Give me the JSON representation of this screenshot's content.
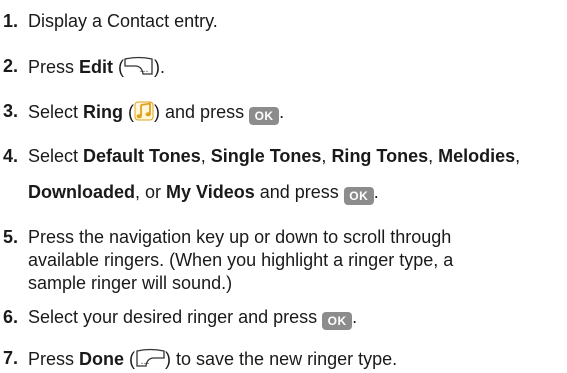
{
  "steps": [
    {
      "num": "1.",
      "parts": {
        "t1": "Display a Contact entry."
      }
    },
    {
      "num": "2.",
      "parts": {
        "t1": "Press ",
        "b1": "Edit",
        "t2": " (",
        "t3": ")."
      }
    },
    {
      "num": "3.",
      "parts": {
        "t1": "Select ",
        "b1": "Ring",
        "t2": " (",
        "t3": ") and press ",
        "t4": "."
      }
    },
    {
      "num": "4.",
      "parts": {
        "t1": "Select ",
        "b1": "Default Tones",
        "t2": ", ",
        "b2": "Single Tones",
        "t3": ", ",
        "b3": "Ring Tones",
        "t4": ", ",
        "b4": "Melodies",
        "t5": ",",
        "b5": "Downloaded",
        "t6": ", or ",
        "b6": "My Videos",
        "t7": " and press ",
        "t8": "."
      }
    },
    {
      "num": "5.",
      "lines": [
        "Press the navigation key up or down to scroll through",
        "available ringers. (When you highlight a ringer type, a",
        "sample ringer will sound.)"
      ]
    },
    {
      "num": "6.",
      "parts": {
        "t1": "Select your desired ringer and press ",
        "t2": "."
      }
    },
    {
      "num": "7.",
      "parts": {
        "t1": "Press ",
        "b1": "Done",
        "t2": " (",
        "t3": ") to save the new ringer type."
      }
    }
  ],
  "ok_key_label": "OK",
  "icons": {
    "edit_softkey": "right-softkey-icon",
    "ring": "music-note-icon",
    "ok_key": "ok-key-icon",
    "done_softkey": "left-softkey-icon"
  },
  "colors": {
    "text": "#1a1a1a",
    "ok_key_bg": "#8c8c8c",
    "ring_icon": "#e0a21a"
  }
}
